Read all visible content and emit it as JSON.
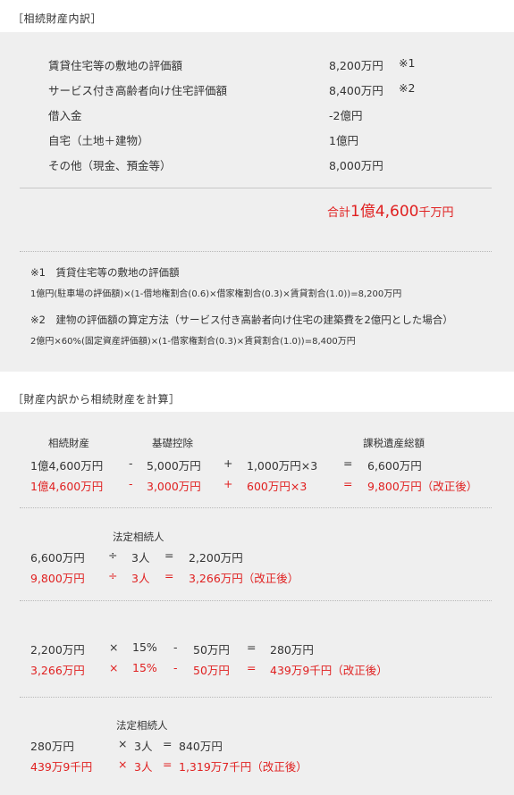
{
  "section1": {
    "heading": "［相続財産内訳］",
    "assets": [
      {
        "label": "賃貸住宅等の敷地の評価額",
        "value": "8,200万円",
        "note": "※1"
      },
      {
        "label": "サービス付き高齢者向け住宅評価額",
        "value": "8,400万円",
        "note": "※2"
      },
      {
        "label": "借入金",
        "value": "-2億円",
        "note": ""
      },
      {
        "label": "自宅（土地＋建物）",
        "value": "1億円",
        "note": ""
      },
      {
        "label": "その他（現金、預金等）",
        "value": "8,000万円",
        "note": ""
      }
    ],
    "total": {
      "prefix": "合計",
      "amount": "1億4,600",
      "unit": "千万円"
    },
    "notes": [
      {
        "title": "※1　賃貸住宅等の敷地の評価額",
        "formula": "1億円(駐車場の評価額)×(1-借地権割合(0.6)×借家権割合(0.3)×賃貸割合(1.0))=8,200万円"
      },
      {
        "title": "※2　建物の評価額の算定方法（サービス付き高齢者向け住宅の建築費を2億円とした場合）",
        "formula": "2億円×60%(固定資産評価額)×(1-借家権割合(0.3)×賃貸割合(1.0))=8,400万円"
      }
    ]
  },
  "section2": {
    "heading": "［財産内訳から相続財産を計算］",
    "block1": {
      "labels": {
        "estate": "相続財産",
        "deduction": "基礎控除",
        "taxable": "課税遺産総額"
      },
      "row1": [
        "1億4,600万円",
        "-",
        "5,000万円",
        "+",
        "1,000万円×3",
        "=",
        "6,600万円"
      ],
      "row2": [
        "1億4,600万円",
        "-",
        "3,000万円",
        "+",
        "600万円×3",
        "=",
        "9,800万円（改正後）"
      ]
    },
    "block2": {
      "label": "法定相続人",
      "row1": [
        "6,600万円",
        "÷",
        "3人",
        "=",
        "2,200万円"
      ],
      "row2": [
        "9,800万円",
        "÷",
        "3人",
        "=",
        "3,266万円（改正後）"
      ]
    },
    "block3": {
      "row1": [
        "2,200万円",
        "×",
        "15%",
        "-",
        "50万円",
        "=",
        "280万円"
      ],
      "row2": [
        "3,266万円",
        "×",
        "15%",
        "-",
        "50万円",
        "=",
        "439万9千円（改正後）"
      ]
    },
    "block4": {
      "label": "法定相続人",
      "row1": [
        "280万円",
        "×",
        "3人",
        "=",
        "840万円"
      ],
      "row2": [
        "439万9千円",
        "×",
        "3人",
        "=",
        "1,319万7千円（改正後）"
      ]
    }
  },
  "colors": {
    "accent_red": "#e02020",
    "panel_bg": "#efefef",
    "text": "#333333"
  }
}
